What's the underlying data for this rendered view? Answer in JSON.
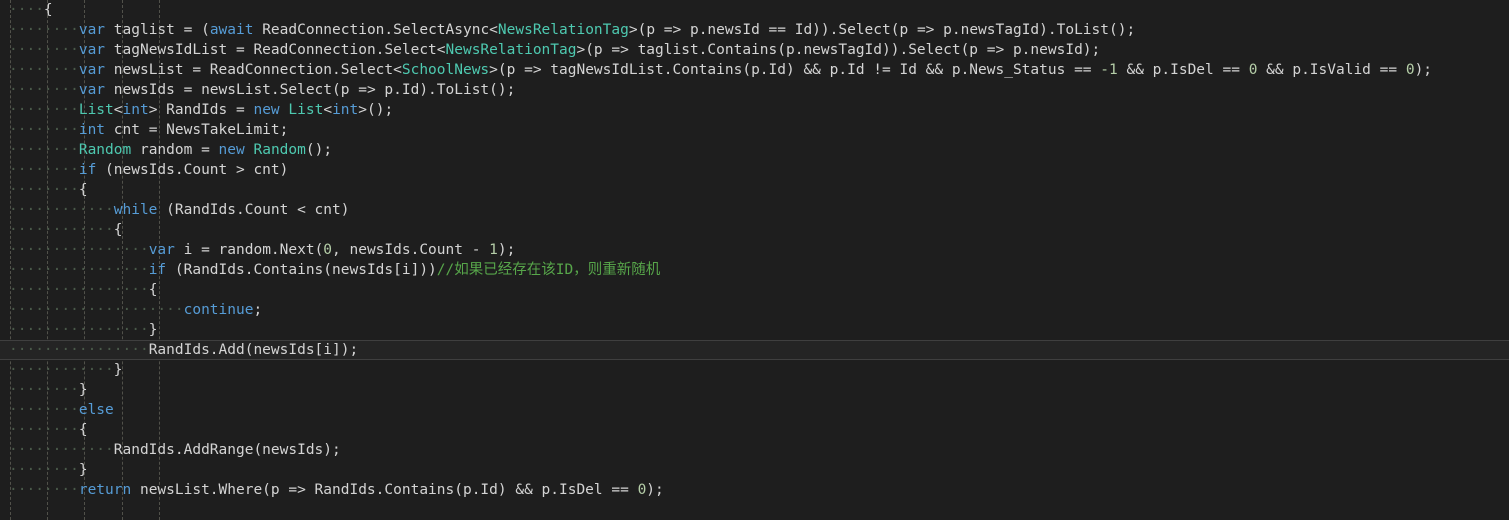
{
  "editor": {
    "name": "code-editor",
    "language": "csharp",
    "background": "#1e1e1e",
    "foreground": "#d4d4d4",
    "current_line_background": "#242424",
    "current_line_border": "#3f3f3f",
    "indent_guide_color": "#5a5a52",
    "whitespace_dot_color": "#4a5a4a",
    "colors": {
      "keyword": "#569cd6",
      "type": "#4ec9b0",
      "number": "#b5cea8",
      "comment": "#57a64a",
      "plain": "#d4d4d4"
    },
    "char_width": 9.31,
    "line_height": 20,
    "indent_size": 4,
    "whitespace_char": "·",
    "current_line_index": 17,
    "indent_guide_columns": [
      0,
      4,
      8,
      12,
      16
    ]
  },
  "lines": [
    {
      "indent": 4,
      "tokens": [
        {
          "t": "{",
          "c": "pl"
        }
      ]
    },
    {
      "indent": 8,
      "tokens": [
        {
          "t": "var",
          "c": "kw"
        },
        {
          "t": " taglist = (",
          "c": "pl"
        },
        {
          "t": "await",
          "c": "kw"
        },
        {
          "t": " ReadConnection.SelectAsync<",
          "c": "pl"
        },
        {
          "t": "NewsRelationTag",
          "c": "type"
        },
        {
          "t": ">(p => p.newsId == Id)).Select(p => p.newsTagId).ToList();",
          "c": "pl"
        }
      ]
    },
    {
      "indent": 8,
      "tokens": [
        {
          "t": "var",
          "c": "kw"
        },
        {
          "t": " tagNewsIdList = ReadConnection.Select<",
          "c": "pl"
        },
        {
          "t": "NewsRelationTag",
          "c": "type"
        },
        {
          "t": ">(p => taglist.Contains(p.newsTagId)).Select(p => p.newsId);",
          "c": "pl"
        }
      ]
    },
    {
      "indent": 8,
      "tokens": [
        {
          "t": "var",
          "c": "kw"
        },
        {
          "t": " newsList = ReadConnection.Select<",
          "c": "pl"
        },
        {
          "t": "SchoolNews",
          "c": "type"
        },
        {
          "t": ">(p => tagNewsIdList.Contains(p.Id) && p.Id != Id && p.News_Status == ",
          "c": "pl"
        },
        {
          "t": "-1",
          "c": "num"
        },
        {
          "t": " && p.IsDel == ",
          "c": "pl"
        },
        {
          "t": "0",
          "c": "num"
        },
        {
          "t": " && p.IsValid == ",
          "c": "pl"
        },
        {
          "t": "0",
          "c": "num"
        },
        {
          "t": ");",
          "c": "pl"
        }
      ]
    },
    {
      "indent": 8,
      "tokens": [
        {
          "t": "var",
          "c": "kw"
        },
        {
          "t": " newsIds = newsList.Select(p => p.Id).ToList();",
          "c": "pl"
        }
      ]
    },
    {
      "indent": 8,
      "tokens": [
        {
          "t": "List",
          "c": "type"
        },
        {
          "t": "<",
          "c": "pl"
        },
        {
          "t": "int",
          "c": "kw"
        },
        {
          "t": "> RandIds = ",
          "c": "pl"
        },
        {
          "t": "new",
          "c": "kw"
        },
        {
          "t": " ",
          "c": "pl"
        },
        {
          "t": "List",
          "c": "type"
        },
        {
          "t": "<",
          "c": "pl"
        },
        {
          "t": "int",
          "c": "kw"
        },
        {
          "t": ">();",
          "c": "pl"
        }
      ]
    },
    {
      "indent": 8,
      "tokens": [
        {
          "t": "int",
          "c": "kw"
        },
        {
          "t": " cnt = NewsTakeLimit;",
          "c": "pl"
        }
      ]
    },
    {
      "indent": 8,
      "tokens": [
        {
          "t": "Random",
          "c": "type"
        },
        {
          "t": " random = ",
          "c": "pl"
        },
        {
          "t": "new",
          "c": "kw"
        },
        {
          "t": " ",
          "c": "pl"
        },
        {
          "t": "Random",
          "c": "type"
        },
        {
          "t": "();",
          "c": "pl"
        }
      ]
    },
    {
      "indent": 8,
      "tokens": [
        {
          "t": "if",
          "c": "kw"
        },
        {
          "t": " (newsIds.Count > cnt)",
          "c": "pl"
        }
      ]
    },
    {
      "indent": 8,
      "tokens": [
        {
          "t": "{",
          "c": "pl"
        }
      ]
    },
    {
      "indent": 12,
      "tokens": [
        {
          "t": "while",
          "c": "kw"
        },
        {
          "t": " (RandIds.Count < cnt)",
          "c": "pl"
        }
      ]
    },
    {
      "indent": 12,
      "tokens": [
        {
          "t": "{",
          "c": "pl"
        }
      ]
    },
    {
      "indent": 16,
      "tokens": [
        {
          "t": "var",
          "c": "kw"
        },
        {
          "t": " i = random.Next(",
          "c": "pl"
        },
        {
          "t": "0",
          "c": "num"
        },
        {
          "t": ", newsIds.Count - ",
          "c": "pl"
        },
        {
          "t": "1",
          "c": "num"
        },
        {
          "t": ");",
          "c": "pl"
        }
      ]
    },
    {
      "indent": 16,
      "tokens": [
        {
          "t": "if",
          "c": "kw"
        },
        {
          "t": " (RandIds.Contains(newsIds[i]))",
          "c": "pl"
        },
        {
          "t": "//如果已经存在该ID，则重新随机",
          "c": "cmt"
        }
      ]
    },
    {
      "indent": 16,
      "tokens": [
        {
          "t": "{",
          "c": "pl"
        }
      ]
    },
    {
      "indent": 20,
      "tokens": [
        {
          "t": "continue",
          "c": "kw"
        },
        {
          "t": ";",
          "c": "pl"
        }
      ]
    },
    {
      "indent": 16,
      "tokens": [
        {
          "t": "}",
          "c": "pl"
        }
      ]
    },
    {
      "indent": 16,
      "current": true,
      "tokens": [
        {
          "t": "RandIds.Add(newsIds[i]);",
          "c": "pl"
        }
      ]
    },
    {
      "indent": 12,
      "tokens": [
        {
          "t": "}",
          "c": "pl"
        }
      ]
    },
    {
      "indent": 8,
      "tokens": [
        {
          "t": "}",
          "c": "pl"
        }
      ]
    },
    {
      "indent": 8,
      "tokens": [
        {
          "t": "else",
          "c": "kw"
        }
      ]
    },
    {
      "indent": 8,
      "tokens": [
        {
          "t": "{",
          "c": "pl"
        }
      ]
    },
    {
      "indent": 12,
      "tokens": [
        {
          "t": "RandIds.AddRange(newsIds);",
          "c": "pl"
        }
      ]
    },
    {
      "indent": 8,
      "tokens": [
        {
          "t": "}",
          "c": "pl"
        }
      ]
    },
    {
      "indent": 8,
      "tokens": [
        {
          "t": "return",
          "c": "kw"
        },
        {
          "t": " newsList.Where(p => RandIds.Contains(p.Id) && p.IsDel == ",
          "c": "pl"
        },
        {
          "t": "0",
          "c": "num"
        },
        {
          "t": ");",
          "c": "pl"
        }
      ]
    }
  ]
}
